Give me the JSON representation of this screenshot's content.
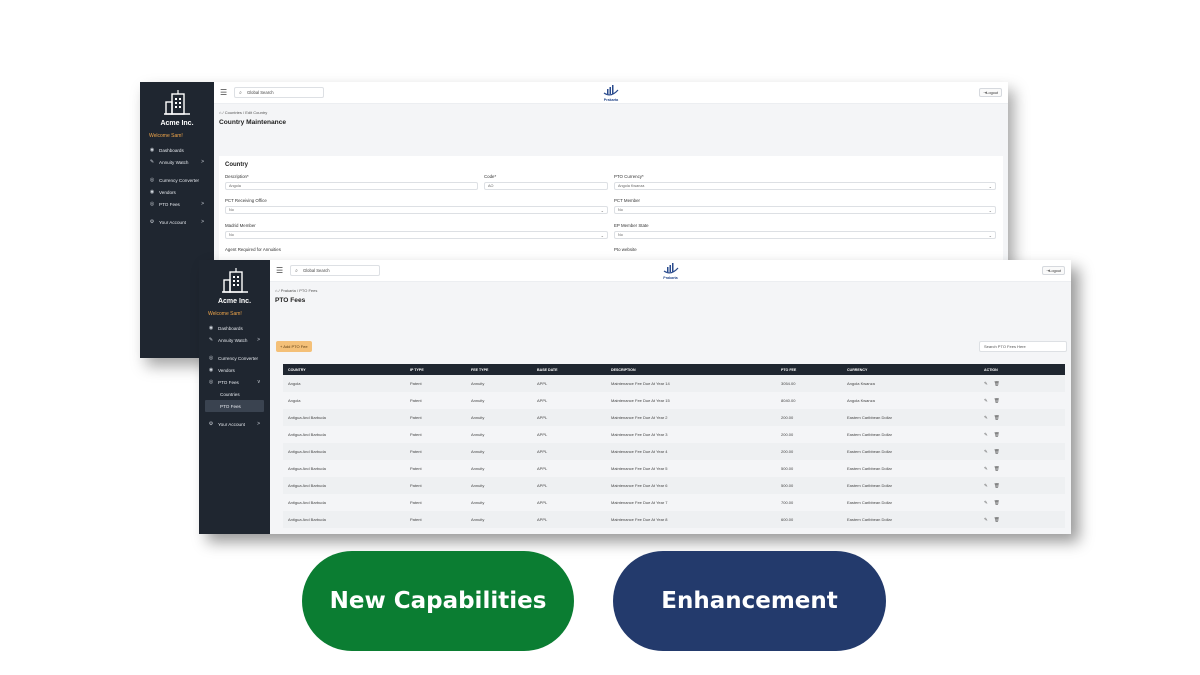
{
  "colors": {
    "sidebar": "#1f2630",
    "accent_orange": "#f4c078",
    "green_pill": "#0b7d32",
    "blue_pill": "#233a6c",
    "welcome": "#f0a64a"
  },
  "back_window": {
    "company": "Acme Inc.",
    "welcome": "Welcome Sam!",
    "nav": [
      {
        "icon": "dashboard-icon",
        "label": "Dashboards"
      },
      {
        "icon": "tag-icon",
        "label": "Annuity Watch",
        "chevron": ">"
      },
      {
        "icon": "exchange-icon",
        "label": "Currency Converter"
      },
      {
        "icon": "vendor-icon",
        "label": "Vendors"
      },
      {
        "icon": "fee-icon",
        "label": "PTO Fees",
        "chevron": ">"
      },
      {
        "icon": "account-icon",
        "label": "Your Account",
        "chevron": ">"
      }
    ],
    "search_placeholder": "Global Search",
    "brand": "Prakarta",
    "logout": "Logout",
    "breadcrumb": "/ Countries / Edit Country",
    "page_title": "Country Maintenance",
    "form": {
      "title": "Country",
      "description_label": "Description*",
      "description_value": "Angola",
      "code_label": "Code*",
      "code_value": "AO",
      "pto_currency_label": "PTO Currency*",
      "pto_currency_value": "Angola Kwanza",
      "pct_receiving_label": "PCT Receiving Office",
      "pct_receiving_value": "No",
      "pct_member_label": "PCT Member",
      "pct_member_value": "No",
      "madrid_label": "Madrid Member",
      "madrid_value": "No",
      "ep_label": "EP Member State",
      "ep_value": "No",
      "agent_label": "Agent Required for Annuities",
      "pto_website_label": "Pto website"
    }
  },
  "front_window": {
    "company": "Acme Inc.",
    "welcome": "Welcome Sam!",
    "nav": [
      {
        "icon": "dashboard-icon",
        "label": "Dashboards"
      },
      {
        "icon": "tag-icon",
        "label": "Annuity Watch",
        "chevron": ">"
      },
      {
        "icon": "exchange-icon",
        "label": "Currency Converter"
      },
      {
        "icon": "vendor-icon",
        "label": "Vendors"
      },
      {
        "icon": "fee-icon",
        "label": "PTO Fees",
        "chevron": "v"
      }
    ],
    "sub_nav": [
      "Countries",
      "PTO Fees"
    ],
    "account": {
      "icon": "account-icon",
      "label": "Your Account",
      "chevron": ">"
    },
    "search_placeholder": "Global Search",
    "brand": "Prakarta",
    "logout": "Logout",
    "breadcrumb": "/ Prakarta / PTO Fees",
    "page_title": "PTO Fees",
    "add_button": "+ Add PTO Fee",
    "table_search": "Search PTO Fees Here",
    "columns": [
      "COUNTRY",
      "IP TYPE",
      "FEE TYPE",
      "BASE DATE",
      "DESCRIPTION",
      "PTO FEE",
      "CURRENCY",
      "ACTION"
    ],
    "rows": [
      [
        "Angola",
        "Patent",
        "Annuity",
        "APPL",
        "Maintenance Fee Due At Year 14",
        "3054.00",
        "Angola Kwanza"
      ],
      [
        "Angola",
        "Patent",
        "Annuity",
        "APPL",
        "Maintenance Fee Due At Year 15",
        "8040.00",
        "Angola Kwanza"
      ],
      [
        "Antigua And Barbuda",
        "Patent",
        "Annuity",
        "APPL",
        "Maintenance Fee Due At Year 2",
        "200.00",
        "Eastern Caribbean Dollar"
      ],
      [
        "Antigua And Barbuda",
        "Patent",
        "Annuity",
        "APPL",
        "Maintenance Fee Due At Year 3",
        "200.00",
        "Eastern Caribbean Dollar"
      ],
      [
        "Antigua And Barbuda",
        "Patent",
        "Annuity",
        "APPL",
        "Maintenance Fee Due At Year 4",
        "200.00",
        "Eastern Caribbean Dollar"
      ],
      [
        "Antigua And Barbuda",
        "Patent",
        "Annuity",
        "APPL",
        "Maintenance Fee Due At Year 5",
        "500.00",
        "Eastern Caribbean Dollar"
      ],
      [
        "Antigua And Barbuda",
        "Patent",
        "Annuity",
        "APPL",
        "Maintenance Fee Due At Year 6",
        "500.00",
        "Eastern Caribbean Dollar"
      ],
      [
        "Antigua And Barbuda",
        "Patent",
        "Annuity",
        "APPL",
        "Maintenance Fee Due At Year 7",
        "700.00",
        "Eastern Caribbean Dollar"
      ],
      [
        "Antigua And Barbuda",
        "Patent",
        "Annuity",
        "APPL",
        "Maintenance Fee Due At Year 8",
        "600.00",
        "Eastern Caribbean Dollar"
      ]
    ]
  },
  "pills": {
    "new_capabilities": "New Capabilities",
    "enhancement": "Enhancement"
  }
}
